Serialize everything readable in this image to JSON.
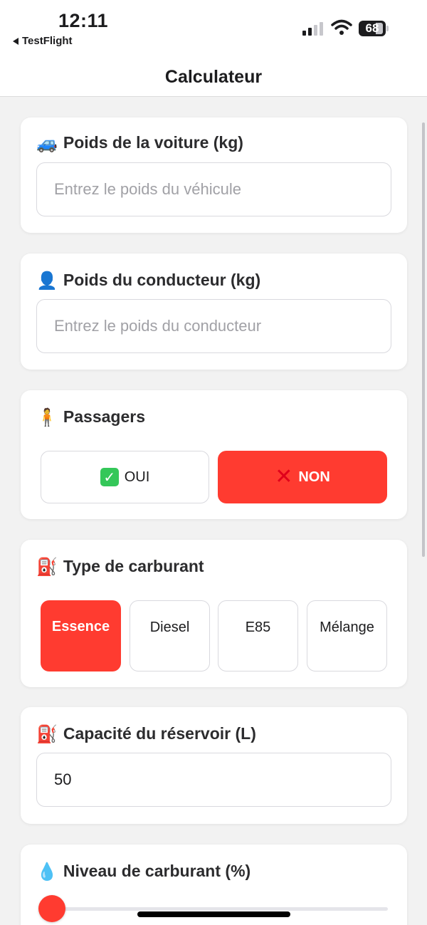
{
  "status_bar": {
    "time": "12:11",
    "back_app": "TestFlight",
    "battery": "68"
  },
  "nav": {
    "title": "Calculateur"
  },
  "car_weight": {
    "icon": "🚙",
    "label": "Poids de la voiture (kg)",
    "placeholder": "Entrez le poids du véhicule"
  },
  "driver_weight": {
    "icon": "👤",
    "label": "Poids du conducteur (kg)",
    "placeholder": "Entrez le poids du conducteur"
  },
  "passengers": {
    "icon": "🧍",
    "label": "Passagers",
    "options": [
      {
        "icon": "✓",
        "label": "OUI",
        "selected": false
      },
      {
        "icon": "✕",
        "label": "NON",
        "selected": true
      }
    ]
  },
  "fuel_type": {
    "icon": "⛽",
    "label": "Type de carburant",
    "options": [
      {
        "label": "Essence",
        "selected": true
      },
      {
        "label": "Diesel",
        "selected": false
      },
      {
        "label": "E85",
        "selected": false
      },
      {
        "label": "Mélange",
        "selected": false
      }
    ]
  },
  "tank_capacity": {
    "icon": "⛽",
    "label": "Capacité du réservoir (L)",
    "value": "50"
  },
  "fuel_level": {
    "icon": "💧",
    "label": "Niveau de carburant (%)",
    "value": 0
  },
  "colors": {
    "accent": "#ff3b30",
    "background": "#f2f2f2",
    "card": "#ffffff",
    "border": "#d9d9de"
  }
}
